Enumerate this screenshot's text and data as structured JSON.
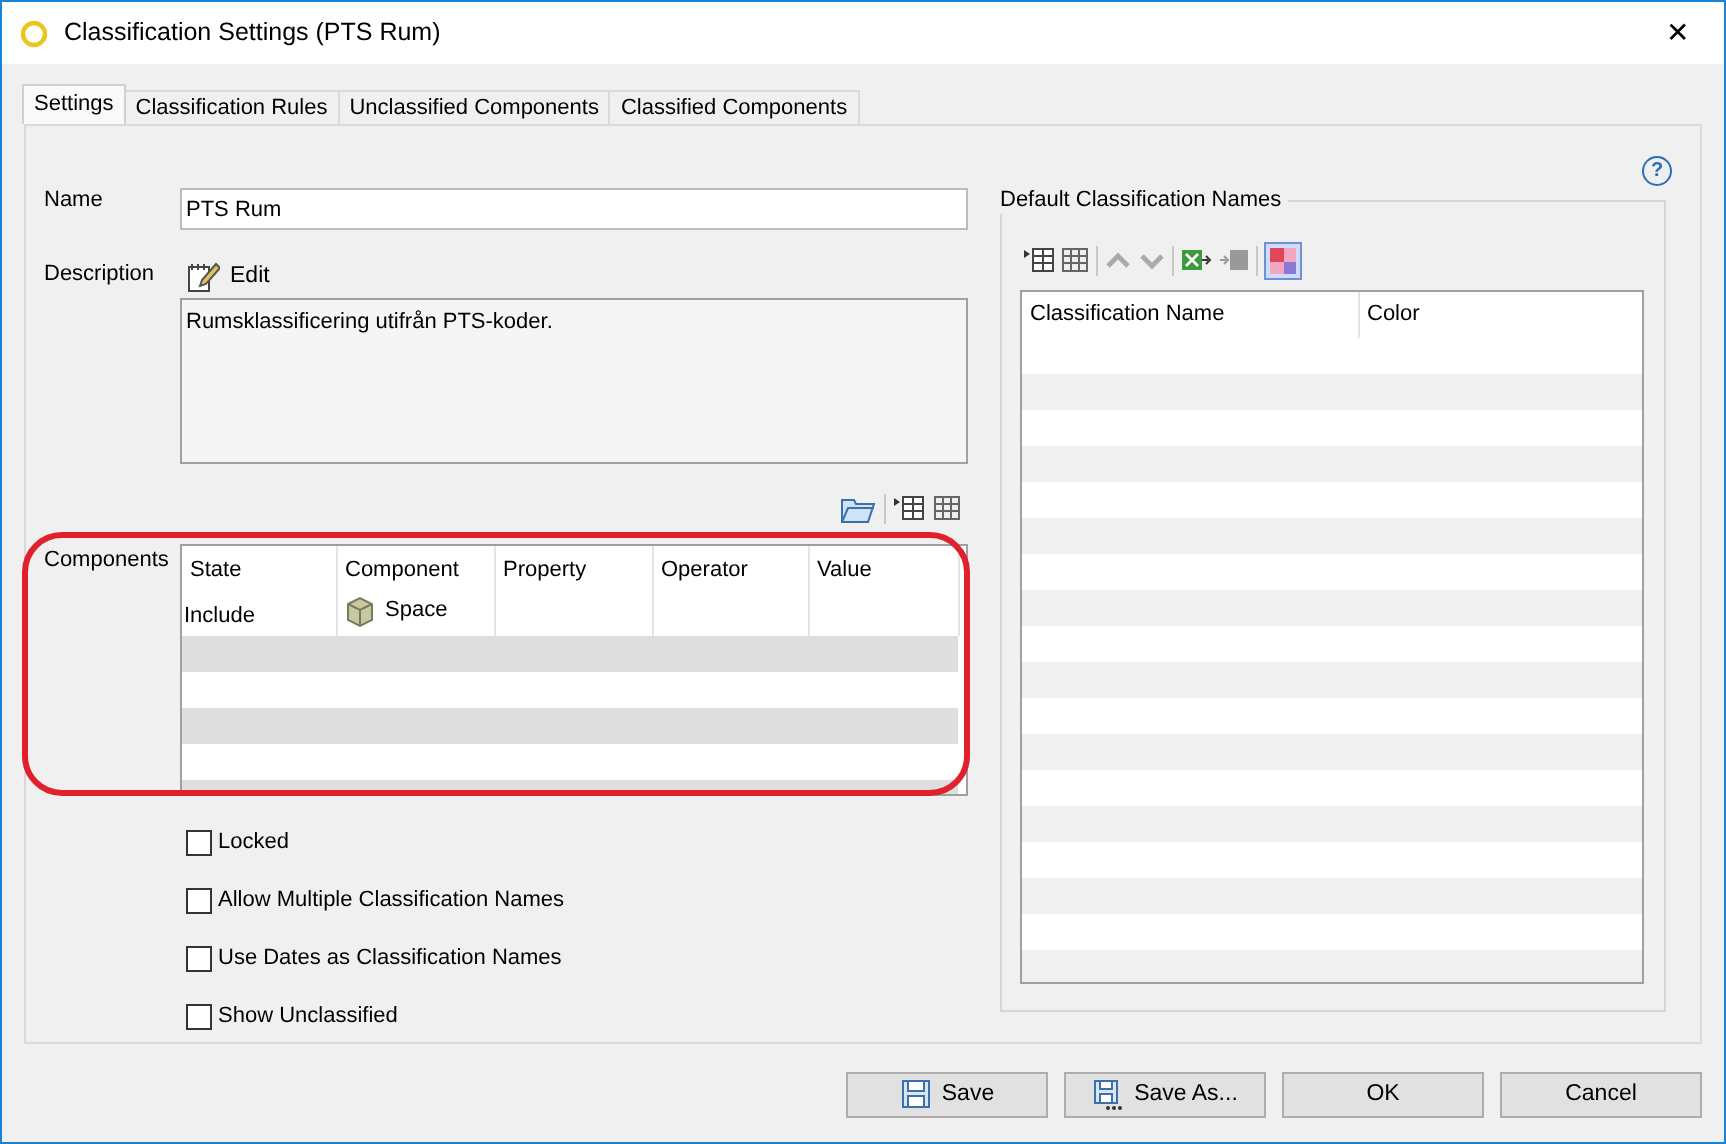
{
  "window": {
    "title": "Classification Settings (PTS Rum)",
    "close": "✕"
  },
  "tabs": [
    {
      "label": "Settings",
      "selected": true
    },
    {
      "label": "Classification Rules",
      "selected": false
    },
    {
      "label": "Unclassified Components",
      "selected": false
    },
    {
      "label": "Classified Components",
      "selected": false
    }
  ],
  "help": "?",
  "name": {
    "label": "Name",
    "value": "PTS Rum"
  },
  "description": {
    "label": "Description",
    "edit": "Edit",
    "value": "Rumsklassificering utifrån PTS-koder."
  },
  "components": {
    "label": "Components",
    "highlighted": true,
    "columns": [
      "State",
      "Component",
      "Property",
      "Operator",
      "Value"
    ],
    "rows": [
      {
        "state": "Include",
        "component": "Space"
      }
    ]
  },
  "options": [
    {
      "label": "Locked",
      "checked": false
    },
    {
      "label": "Allow Multiple Classification Names",
      "checked": false
    },
    {
      "label": "Use Dates as Classification Names",
      "checked": false
    },
    {
      "label": "Show Unclassified",
      "checked": false
    }
  ],
  "default_names": {
    "title": "Default Classification Names",
    "columns": [
      "Classification Name",
      "Color"
    ]
  },
  "buttons": [
    {
      "label": "Save",
      "kind": "save"
    },
    {
      "label": "Save As...",
      "kind": "save-as"
    },
    {
      "label": "OK",
      "kind": "plain"
    },
    {
      "label": "Cancel",
      "kind": "plain"
    }
  ]
}
